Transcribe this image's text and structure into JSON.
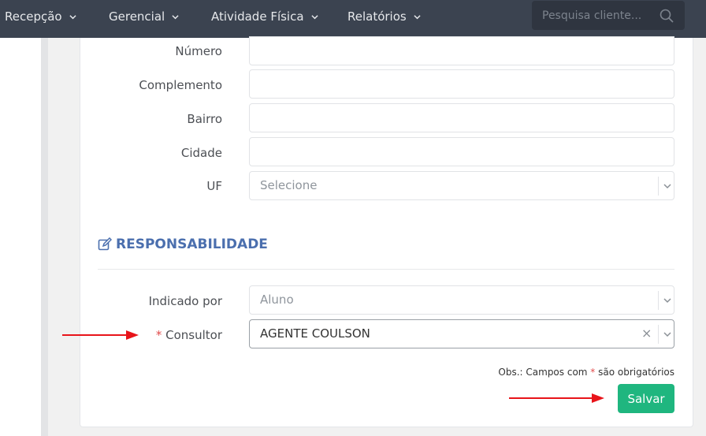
{
  "navbar": {
    "items": [
      {
        "label": "Recepção"
      },
      {
        "label": "Gerencial"
      },
      {
        "label": "Atividade Física"
      },
      {
        "label": "Relatórios"
      }
    ],
    "search_placeholder": "Pesquisa cliente..."
  },
  "address": {
    "numero_label": "Número",
    "complemento_label": "Complemento",
    "bairro_label": "Bairro",
    "cidade_label": "Cidade",
    "uf_label": "UF",
    "uf_value": "Selecione"
  },
  "responsabilidade": {
    "title": "RESPONSABILIDADE",
    "indicado_label": "Indicado por",
    "indicado_value": "Aluno",
    "consultor_required": "*",
    "consultor_label": "Consultor",
    "consultor_value": "AGENTE COULSON"
  },
  "footer": {
    "obs_prefix": "Obs.: Campos com",
    "obs_star": "*",
    "obs_suffix": "são obrigatórios",
    "save_label": "Salvar"
  },
  "colors": {
    "navbar": "#3b4350",
    "section_title": "#4b6fae",
    "save_button": "#1fb67f",
    "annotation_arrow": "#e8141a"
  }
}
